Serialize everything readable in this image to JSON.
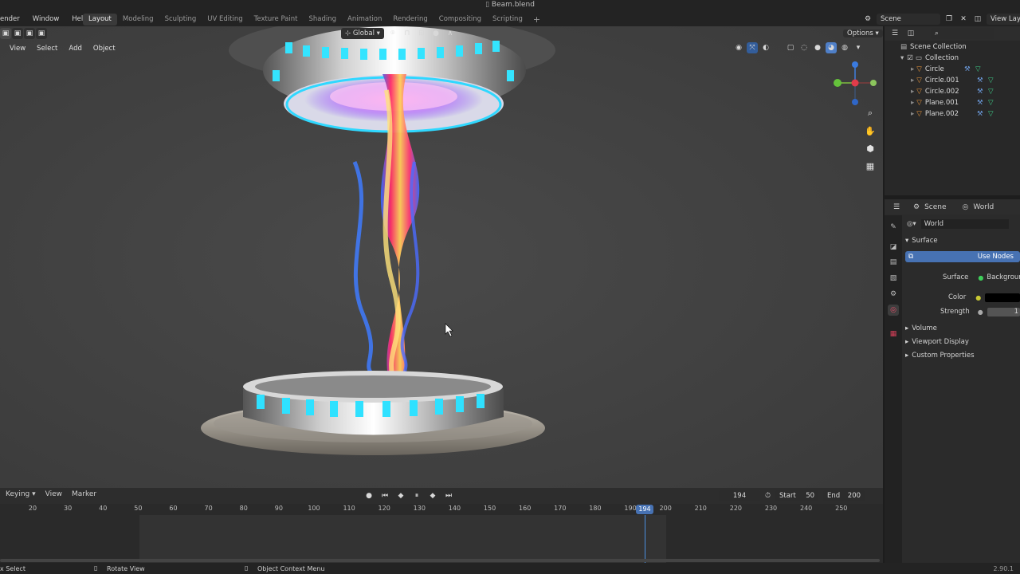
{
  "window": {
    "title": "Beam.blend"
  },
  "menus": [
    "ender",
    "Window",
    "Help"
  ],
  "workspace_tabs": [
    {
      "label": "Layout",
      "active": true
    },
    {
      "label": "Modeling",
      "active": false
    },
    {
      "label": "Sculpting",
      "active": false
    },
    {
      "label": "UV Editing",
      "active": false
    },
    {
      "label": "Texture Paint",
      "active": false
    },
    {
      "label": "Shading",
      "active": false
    },
    {
      "label": "Animation",
      "active": false
    },
    {
      "label": "Rendering",
      "active": false
    },
    {
      "label": "Compositing",
      "active": false
    },
    {
      "label": "Scripting",
      "active": false
    }
  ],
  "top_right": {
    "scene": "Scene",
    "view_layer": "View Lay"
  },
  "viewport": {
    "header_menus": [
      "View",
      "Select",
      "Add",
      "Object"
    ],
    "transform_orientation": "Global",
    "options_label": "Options"
  },
  "outliner": {
    "root": "Scene Collection",
    "collection": "Collection",
    "objects": [
      "Circle",
      "Circle.001",
      "Circle.002",
      "Plane.001",
      "Plane.002"
    ]
  },
  "properties": {
    "breadcrumb": {
      "scene": "Scene",
      "world": "World"
    },
    "datablock": "World",
    "panels": {
      "surface": "Surface",
      "use_nodes": "Use Nodes",
      "volume": "Volume",
      "viewport_display": "Viewport Display",
      "custom_properties": "Custom Properties"
    },
    "fields": {
      "surface_label": "Surface",
      "surface_value": "Background",
      "color_label": "Color",
      "strength_label": "Strength",
      "strength_value": "1"
    }
  },
  "timeline": {
    "menus": [
      "Keying",
      "View",
      "Marker"
    ],
    "current_frame": "194",
    "start_label": "Start",
    "start_value": "50",
    "end_label": "End",
    "end_value": "200",
    "ruler": [
      "20",
      "30",
      "40",
      "50",
      "60",
      "70",
      "80",
      "90",
      "100",
      "110",
      "120",
      "130",
      "140",
      "150",
      "160",
      "170",
      "180",
      "190",
      "200",
      "210",
      "220",
      "230",
      "240",
      "250"
    ],
    "playhead": "194"
  },
  "statusbar": {
    "select": "x Select",
    "rotate": "Rotate View",
    "context": "Object Context Menu",
    "version": "2.90.1"
  }
}
